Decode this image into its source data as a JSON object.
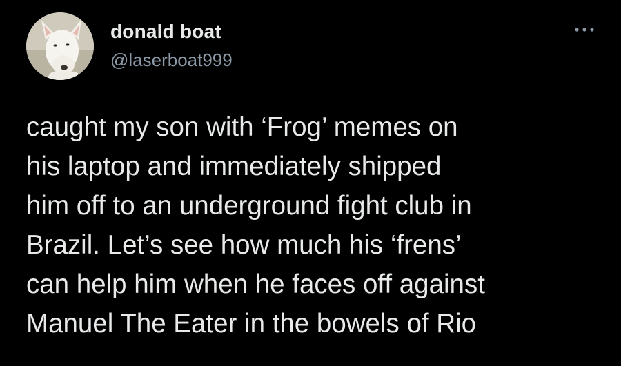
{
  "author": {
    "display_name": "donald boat",
    "handle": "@laserboat999",
    "avatar_icon": "bull-terrier-avatar"
  },
  "menu": {
    "more_icon": "more-options-icon"
  },
  "tweet": {
    "text": "caught my son with ‘Frog’ memes on\nhis laptop and immediately shipped\nhim off to an underground fight club in\nBrazil. Let’s see how much his ‘frens’\ncan help him when he faces off against\nManuel The Eater in the bowels of Rio"
  },
  "colors": {
    "background": "#000000",
    "text_primary": "#e7e9ea",
    "text_secondary": "#8b98a5"
  }
}
